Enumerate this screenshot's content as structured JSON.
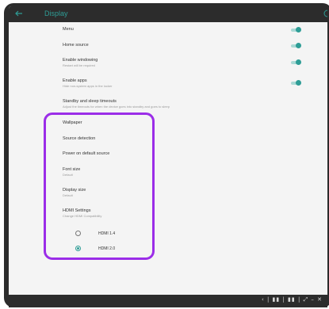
{
  "header": {
    "title": "Display",
    "back_icon": "arrow-left-icon",
    "right_icon": "info-icon"
  },
  "settings": [
    {
      "title": "Menu",
      "subtitle": "",
      "toggle": true
    },
    {
      "title": "Home source",
      "subtitle": "",
      "toggle": true
    },
    {
      "title": "Enable windowing",
      "subtitle": "Restart will be required",
      "toggle": true
    },
    {
      "title": "Enable apps",
      "subtitle": "Hide non-system apps in the locker",
      "toggle": true
    },
    {
      "title": "Standby and sleep timeouts",
      "subtitle": "Adjust the timeouts for when the device goes into standby and goes to sleep"
    },
    {
      "title": "Wallpaper",
      "subtitle": ""
    },
    {
      "title": "Source detection",
      "subtitle": ""
    },
    {
      "title": "Power on default source",
      "subtitle": ""
    },
    {
      "title": "Font size",
      "subtitle": "Default"
    },
    {
      "title": "Display size",
      "subtitle": "Default"
    },
    {
      "title": "HDMI Settings",
      "subtitle": "Change HDMI Compatibility"
    }
  ],
  "hdmi_options": [
    {
      "label": "HDMI 1.4",
      "selected": false
    },
    {
      "label": "HDMI 2.0",
      "selected": true
    }
  ],
  "navbar": {
    "items": "‹ | ▮▮ | ▮▮ | ⤢ – ✕"
  },
  "colors": {
    "accent": "#2e9d96",
    "highlight": "#9b2de8",
    "bezel": "#2c2c2c",
    "background": "#f4f4f4"
  }
}
